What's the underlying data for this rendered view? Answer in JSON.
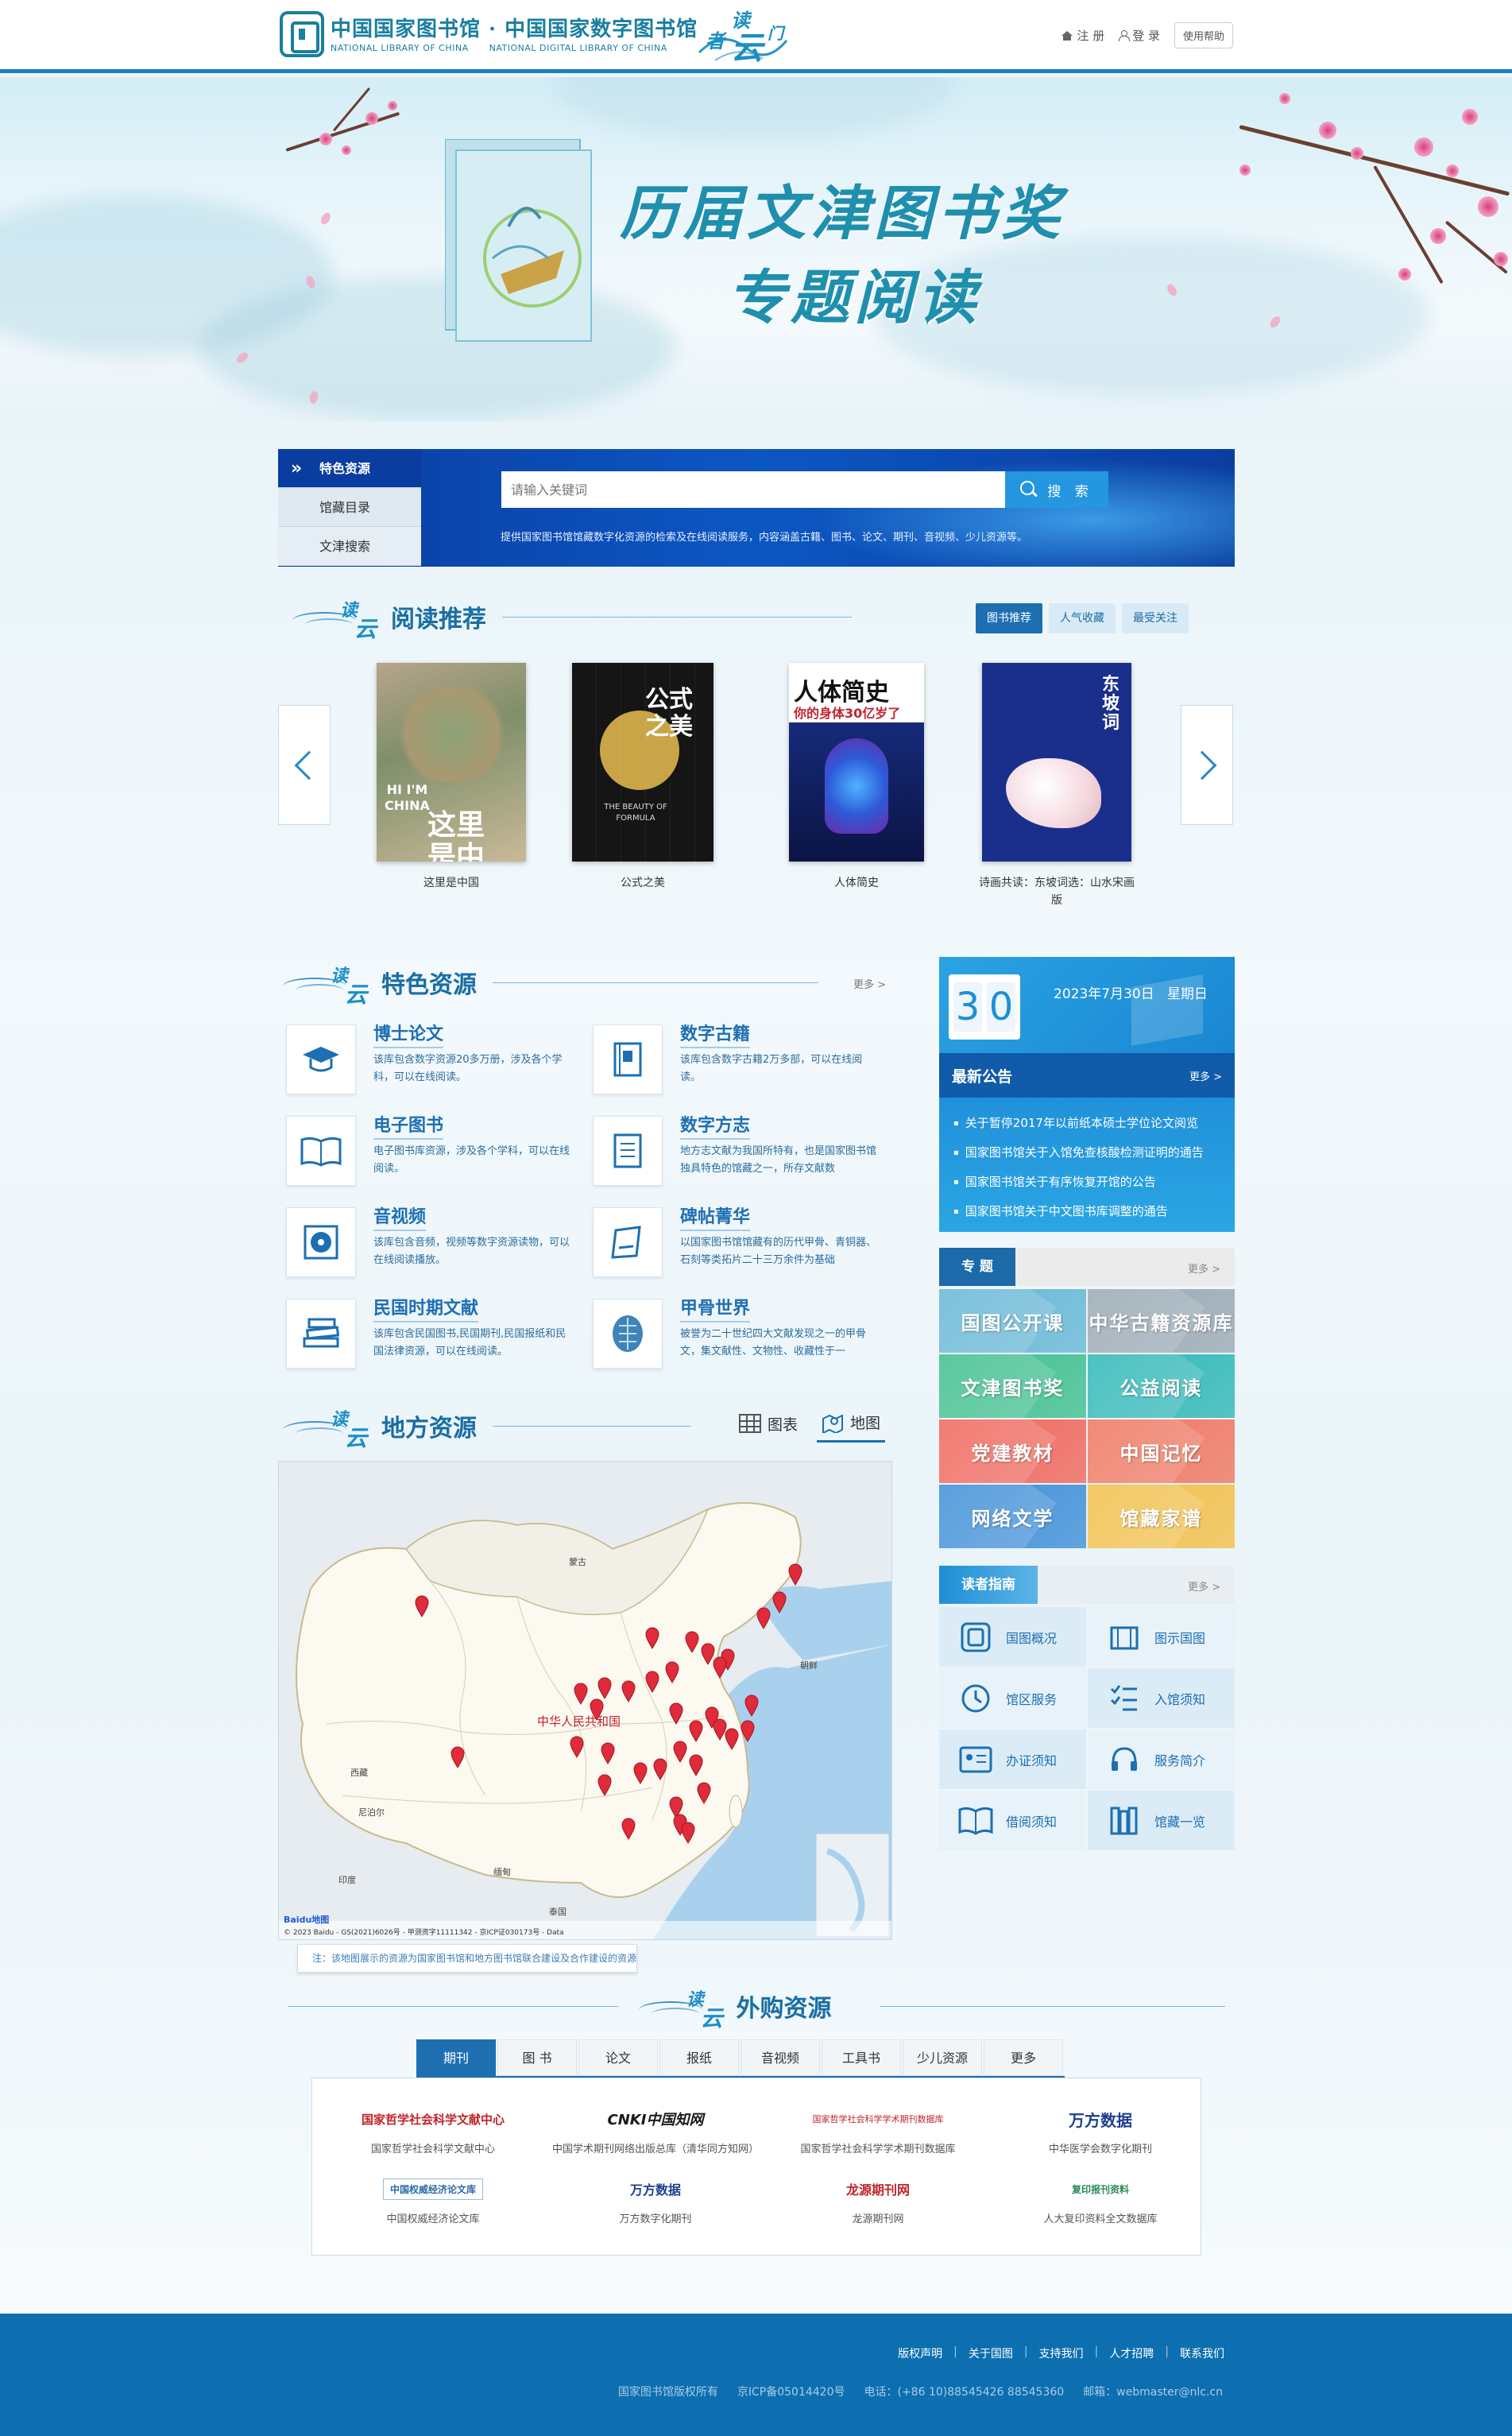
{
  "header": {
    "logo_cn": "中国国家图书馆 · 中国国家数字图书馆",
    "logo_en_1": "NATIONAL LIBRARY OF CHINA",
    "logo_en_2": "NATIONAL DIGITAL LIBRARY OF CHINA",
    "brand_chars": [
      "读",
      "者",
      "云",
      "门"
    ],
    "register": "注 册",
    "login": "登 录",
    "help": "使用帮助"
  },
  "hero": {
    "title_line1": "历届文津图书奖",
    "title_line2": "专题阅读"
  },
  "search": {
    "tabs": [
      "特色资源",
      "馆藏目录",
      "文津搜索"
    ],
    "placeholder": "请输入关键词",
    "button": "搜 索",
    "description": "提供国家图书馆馆藏数字化资源的检索及在线阅读服务，内容涵盖古籍、图书、论文、期刊、音视频、少儿资源等。"
  },
  "reading": {
    "title": "阅读推荐",
    "tabs": [
      "图书推荐",
      "人气收藏",
      "最受关注"
    ],
    "books": [
      {
        "name": "这里是中国"
      },
      {
        "name": "公式之美"
      },
      {
        "name": "人体简史"
      },
      {
        "name": "诗画共读：东坡词选：山水宋画版"
      }
    ],
    "covers": {
      "book1_lines": [
        "HI I'M",
        "CHINA"
      ],
      "book1_title": "这里是中国",
      "book2_title": "公式之美",
      "book2_sub": "THE BEAUTY OF FORMULA",
      "book3_title": "人体简史",
      "book3_sub": "你的身体30亿岁了",
      "book4_title": "东坡词"
    }
  },
  "features": {
    "title": "特色资源",
    "more": "更多 >",
    "items": [
      {
        "title": "博士论文",
        "desc": "该库包含数字资源20多万册，涉及各个学科，可以在线阅读。",
        "icon": "graduation-cap-icon"
      },
      {
        "title": "数字古籍",
        "desc": "该库包含数字古籍2万多部，可以在线阅读。",
        "icon": "ancient-book-icon"
      },
      {
        "title": "电子图书",
        "desc": "电子图书库资源，涉及各个学科，可以在线阅读。",
        "icon": "open-book-icon"
      },
      {
        "title": "数字方志",
        "desc": "地方志文献为我国所特有，也是国家图书馆独具特色的馆藏之一，所存文献数",
        "icon": "document-icon"
      },
      {
        "title": "音视频",
        "desc": "该库包含音频，视频等数字资源读物，可以在线阅读播放。",
        "icon": "disc-icon"
      },
      {
        "title": "碑帖菁华",
        "desc": "以国家图书馆馆藏有的历代甲骨、青铜器、石刻等类拓片二十三万余件为基础",
        "icon": "scroll-icon"
      },
      {
        "title": "民国时期文献",
        "desc": "该库包含民国图书,民国期刊,民国报纸和民国法律资源，可以在线阅读。",
        "icon": "book-stack-icon"
      },
      {
        "title": "甲骨世界",
        "desc": "被誉为二十世纪四大文献发现之一的甲骨文，集文献性、文物性、收藏性于一",
        "icon": "oracle-bone-icon"
      }
    ]
  },
  "calendar": {
    "day_digits": [
      "3",
      "0"
    ],
    "date_text": "2023年7月30日",
    "weekday": "星期日"
  },
  "notices": {
    "title": "最新公告",
    "more": "更多 >",
    "items": [
      "关于暂停2017年以前纸本硕士学位论文阅览",
      "国家图书馆关于入馆免查核酸检测证明的通告",
      "国家图书馆关于有序恢复开馆的公告",
      "国家图书馆关于中文图书库调整的通告"
    ]
  },
  "topics": {
    "title": "专  题",
    "more": "更多 >",
    "items": [
      {
        "label": "国图公开课",
        "color": "#66b7d6"
      },
      {
        "label": "中华古籍资源库",
        "color": "#9aa9b4"
      },
      {
        "label": "文津图书奖",
        "color": "#3fbf8f"
      },
      {
        "label": "公益阅读",
        "color": "#2fb7b7"
      },
      {
        "label": "党建教材",
        "color": "#f0665b"
      },
      {
        "label": "中国记忆",
        "color": "#f07660"
      },
      {
        "label": "网络文学",
        "color": "#3f8fd8"
      },
      {
        "label": "馆藏家谱",
        "color": "#f3c04a"
      }
    ]
  },
  "guide": {
    "title": "读者指南",
    "more": "更多 >",
    "items": [
      {
        "label": "国图概况",
        "icon": "library-logo-icon"
      },
      {
        "label": "图示国图",
        "icon": "building-icon"
      },
      {
        "label": "馆区服务",
        "icon": "clock-icon"
      },
      {
        "label": "入馆须知",
        "icon": "checklist-icon"
      },
      {
        "label": "办证须知",
        "icon": "id-card-icon"
      },
      {
        "label": "服务简介",
        "icon": "headset-icon"
      },
      {
        "label": "借阅须知",
        "icon": "reading-book-icon"
      },
      {
        "label": "馆藏一览",
        "icon": "bookshelf-icon"
      }
    ]
  },
  "local": {
    "title": "地方资源",
    "tab_chart": "图表",
    "tab_map": "地图",
    "map_labels": {
      "mongolia": "蒙古",
      "china": "中华人民共和国",
      "korea": "朝鲜",
      "tibet": "西藏",
      "nepal": "尼泊尔",
      "india": "印度",
      "myanmar": "缅甸",
      "thailand": "泰国"
    },
    "attribution": "© 2023 Baidu - GS(2021)6026号 - 甲测资字11111342 - 京ICP证030173号 - Data",
    "baidu": "Baidu地图",
    "note": "注：该地图展示的资源为国家图书馆和地方图书馆联合建设及合作建设的资源"
  },
  "external": {
    "title": "外购资源",
    "tabs": [
      "期刊",
      "图 书",
      "论文",
      "报纸",
      "音视频",
      "工具书",
      "少儿资源",
      "更多"
    ],
    "items": [
      {
        "logo": "国家哲学社会科学文献中心",
        "name": "国家哲学社会科学文献中心"
      },
      {
        "logo": "CNKI中国知网",
        "name": "中国学术期刊网络出版总库（清华同方知网）"
      },
      {
        "logo": "国家哲学社会科学学术期刊数据库",
        "name": "国家哲学社会科学学术期刊数据库"
      },
      {
        "logo": "万方数据",
        "name": "中华医学会数字化期刊"
      },
      {
        "logo": "中国权威经济论文库",
        "name": "中国权威经济论文库"
      },
      {
        "logo": "万方数据",
        "name": "万方数字化期刊"
      },
      {
        "logo": "龙源期刊网",
        "name": "龙源期刊网"
      },
      {
        "logo": "复印报刊资料",
        "name": "人大复印资料全文数据库"
      }
    ]
  },
  "footer": {
    "links": [
      "版权声明",
      "关于国图",
      "支持我们",
      "人才招聘",
      "联系我们"
    ],
    "copy": [
      "国家图书馆版权所有",
      "京ICP备05014420号",
      "电话：(+86 10)88545426 88545360",
      "邮箱：webmaster@nlc.cn"
    ]
  }
}
